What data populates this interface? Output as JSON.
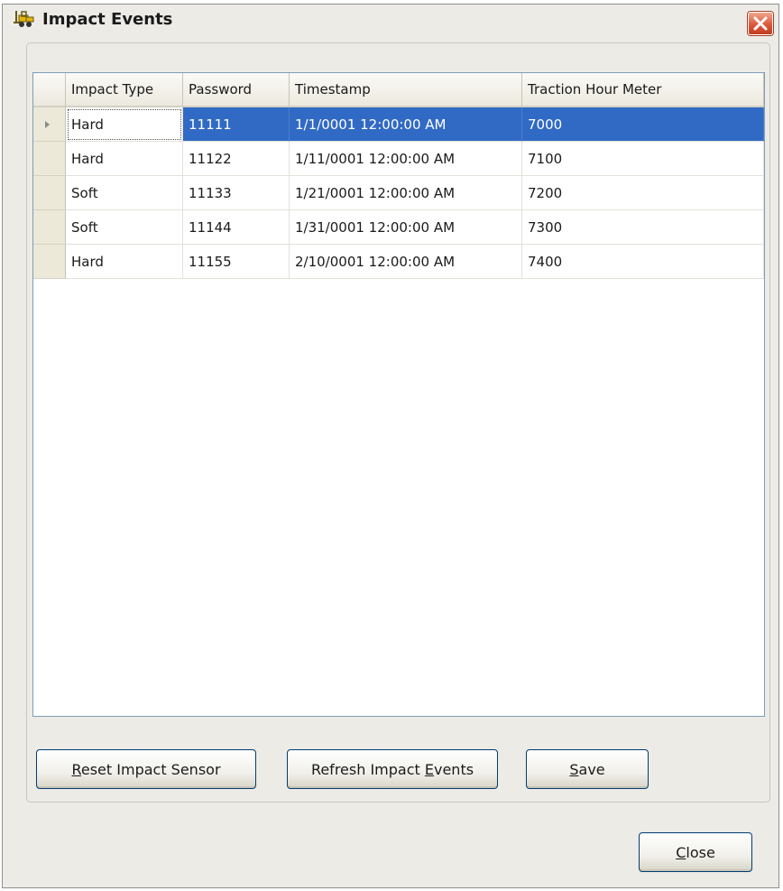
{
  "window": {
    "title": "Impact Events",
    "icon": "forklift-icon"
  },
  "grid": {
    "columns": [
      "Impact Type",
      "Password",
      "Timestamp",
      "Traction Hour Meter"
    ],
    "rows": [
      [
        "Hard",
        "11111",
        "1/1/0001 12:00:00 AM",
        "7000"
      ],
      [
        "Hard",
        "11122",
        "1/11/0001 12:00:00 AM",
        "7100"
      ],
      [
        "Soft",
        "11133",
        "1/21/0001 12:00:00 AM",
        "7200"
      ],
      [
        "Soft",
        "11144",
        "1/31/0001 12:00:00 AM",
        "7300"
      ],
      [
        "Hard",
        "11155",
        "2/10/0001 12:00:00 AM",
        "7400"
      ]
    ]
  },
  "buttons": {
    "reset": {
      "mnemonic": "R",
      "rest": "eset Impact Sensor"
    },
    "refresh": {
      "before": "Refresh Impact ",
      "mnemonic": "E",
      "rest": "vents"
    },
    "save": {
      "mnemonic": "S",
      "rest": "ave"
    },
    "close": {
      "mnemonic": "C",
      "rest": "lose"
    }
  },
  "colors": {
    "selection": "#316ac5",
    "close_button": "#dc5a3c",
    "window_bg": "#ecebe6"
  }
}
